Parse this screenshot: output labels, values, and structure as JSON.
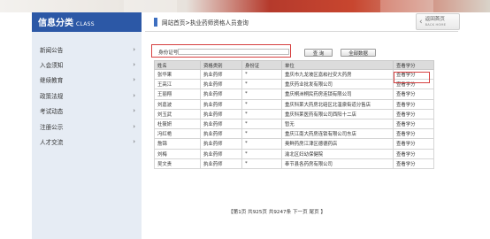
{
  "sidebar": {
    "title": "信息分类",
    "title_en": "CLASS",
    "items": [
      {
        "label": "新闻公告"
      },
      {
        "label": "入会须知"
      },
      {
        "label": "继续教育"
      },
      {
        "label": "政策法规"
      },
      {
        "label": "考试动态"
      },
      {
        "label": "注册公示"
      },
      {
        "label": "人才交流"
      }
    ],
    "arrow": "›"
  },
  "breadcrumb": "网站首页>执业药师资格人员查询",
  "back": {
    "label": "返回首页",
    "label_en": "BACK HOME",
    "chevron": "‹"
  },
  "search": {
    "label": "身份证号：",
    "value": "",
    "query_button": "查 询",
    "all_button": "全部数据"
  },
  "table": {
    "headers": [
      "姓名",
      "资格类别",
      "身份证",
      "单位",
      "查看学分"
    ],
    "rows": [
      {
        "name": "张华果",
        "type": "执业药师",
        "id": "*",
        "unit": "重庆市九龙坡区嘉崧社安大药房",
        "action": "查看学分"
      },
      {
        "name": "王高江",
        "type": "执业药师",
        "id": "*",
        "unit": "重庆药业批发有限公司",
        "action": "查看学分"
      },
      {
        "name": "王丽翔",
        "type": "执业药师",
        "id": "*",
        "unit": "重庆桐洲桐民药房连锁有限公司",
        "action": "查看学分"
      },
      {
        "name": "刘嘉波",
        "type": "执业药师",
        "id": "*",
        "unit": "重庆科莱大药房北碚区北温泉街道分售店",
        "action": "查看学分"
      },
      {
        "name": "刘玉武",
        "type": "执业药师",
        "id": "*",
        "unit": "重庆科莱医药有限公司西阳十二店",
        "action": "查看学分"
      },
      {
        "name": "杜筱妍",
        "type": "执业药师",
        "id": "*",
        "unit": "暂无",
        "action": "查看学分"
      },
      {
        "name": "冯红艳",
        "type": "执业药师",
        "id": "*",
        "unit": "重庆江南大药房连锁有限公司东店",
        "action": "查看学分"
      },
      {
        "name": "詹锦",
        "type": "执业药师",
        "id": "*",
        "unit": "奥鲜药房江津区德德药店",
        "action": "查看学分"
      },
      {
        "name": "刘梅",
        "type": "执业药师",
        "id": "*",
        "unit": "渝北区妇幼保健院",
        "action": "查看学分"
      },
      {
        "name": "吴文贵",
        "type": "执业药师",
        "id": "*",
        "unit": "奉节县各药房有限公司",
        "action": "查看学分"
      }
    ]
  },
  "pager": "【第1页 共925页 共9247条 下一页 尾页 】"
}
